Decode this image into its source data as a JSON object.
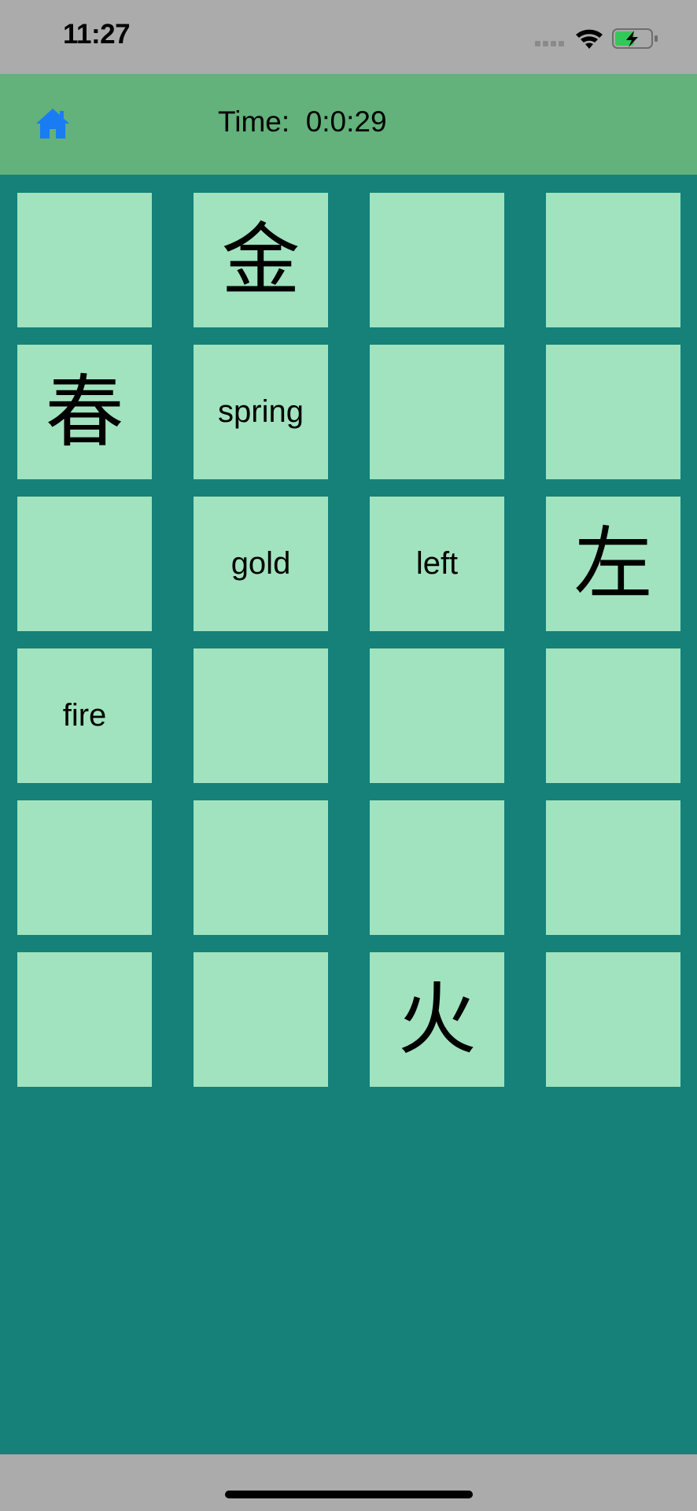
{
  "status_bar": {
    "time": "11:27"
  },
  "header": {
    "time_label": "Time:",
    "time_value": "0:0:29",
    "home_icon": "home-icon"
  },
  "colors": {
    "header": "#63b17b",
    "board": "#158178",
    "card": "#a1e3be",
    "home_icon": "#1a7cf2"
  },
  "cards": [
    {
      "content": "",
      "kind": "blank"
    },
    {
      "content": "金",
      "kind": "hanzi"
    },
    {
      "content": "",
      "kind": "blank"
    },
    {
      "content": "",
      "kind": "blank"
    },
    {
      "content": "春",
      "kind": "hanzi"
    },
    {
      "content": "spring",
      "kind": "text"
    },
    {
      "content": "",
      "kind": "blank"
    },
    {
      "content": "",
      "kind": "blank"
    },
    {
      "content": "",
      "kind": "blank"
    },
    {
      "content": "gold",
      "kind": "text"
    },
    {
      "content": "left",
      "kind": "text"
    },
    {
      "content": "左",
      "kind": "hanzi"
    },
    {
      "content": "fire",
      "kind": "text"
    },
    {
      "content": "",
      "kind": "blank"
    },
    {
      "content": "",
      "kind": "blank"
    },
    {
      "content": "",
      "kind": "blank"
    },
    {
      "content": "",
      "kind": "blank"
    },
    {
      "content": "",
      "kind": "blank"
    },
    {
      "content": "",
      "kind": "blank"
    },
    {
      "content": "",
      "kind": "blank"
    },
    {
      "content": "",
      "kind": "blank"
    },
    {
      "content": "",
      "kind": "blank"
    },
    {
      "content": "火",
      "kind": "hanzi"
    },
    {
      "content": "",
      "kind": "blank"
    }
  ]
}
